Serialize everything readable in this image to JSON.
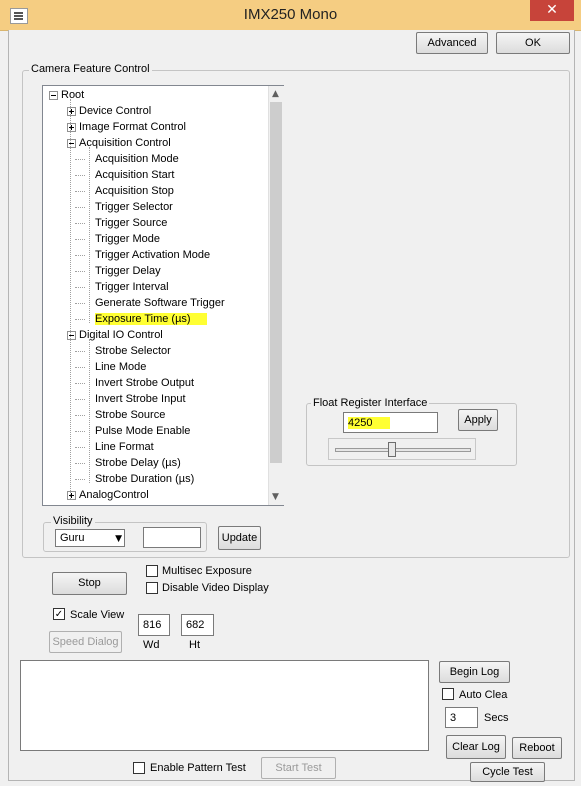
{
  "window": {
    "title": "IMX250 Mono",
    "close_glyph": "✕"
  },
  "header_buttons": {
    "advanced": "Advanced",
    "ok": "OK"
  },
  "feature_group": {
    "label": "Camera Feature Control"
  },
  "tree": {
    "items": [
      {
        "label": "Root",
        "level": 0,
        "expander": "minus"
      },
      {
        "label": "Device Control",
        "level": 1,
        "expander": "plus"
      },
      {
        "label": "Image Format Control",
        "level": 1,
        "expander": "plus"
      },
      {
        "label": "Acquisition Control",
        "level": 1,
        "expander": "minus"
      },
      {
        "label": "Acquisition Mode",
        "level": 2
      },
      {
        "label": "Acquisition Start",
        "level": 2
      },
      {
        "label": "Acquisition Stop",
        "level": 2
      },
      {
        "label": "Trigger Selector",
        "level": 2
      },
      {
        "label": "Trigger Source",
        "level": 2
      },
      {
        "label": "Trigger Mode",
        "level": 2
      },
      {
        "label": "Trigger Activation Mode",
        "level": 2
      },
      {
        "label": "Trigger Delay",
        "level": 2
      },
      {
        "label": "Trigger Interval",
        "level": 2
      },
      {
        "label": "Generate Software Trigger",
        "level": 2
      },
      {
        "label": "Exposure Time (µs)",
        "level": 2,
        "selected": true
      },
      {
        "label": "Digital IO Control",
        "level": 1,
        "expander": "minus"
      },
      {
        "label": "Strobe Selector",
        "level": 2
      },
      {
        "label": "Line Mode",
        "level": 2
      },
      {
        "label": "Invert Strobe Output",
        "level": 2
      },
      {
        "label": "Invert Strobe Input",
        "level": 2
      },
      {
        "label": "Strobe Source",
        "level": 2
      },
      {
        "label": "Pulse Mode Enable",
        "level": 2
      },
      {
        "label": "Line Format",
        "level": 2
      },
      {
        "label": "Strobe Delay (µs)",
        "level": 2
      },
      {
        "label": "Strobe Duration (µs)",
        "level": 2
      },
      {
        "label": "AnalogControl",
        "level": 1,
        "expander": "plus"
      }
    ]
  },
  "float_register": {
    "label": "Float Register Interface",
    "value": "4250",
    "apply": "Apply",
    "slider_fraction": 0.42
  },
  "visibility": {
    "label": "Visibility",
    "selected": "Guru",
    "update": "Update"
  },
  "controls": {
    "stop": "Stop",
    "multisec_exposure": "Multisec Exposure",
    "multisec_checked": false,
    "disable_video": "Disable Video Display",
    "disable_video_checked": false,
    "scale_view": "Scale View",
    "scale_view_checked": true,
    "speed_dialog": "Speed Dialog",
    "width_value": "816",
    "width_label": "Wd",
    "height_value": "682",
    "height_label": "Ht"
  },
  "log": {
    "begin_log": "Begin Log",
    "auto_clear": "Auto Clea",
    "auto_clear_checked": false,
    "secs_value": "3",
    "secs_label": "Secs",
    "clear_log": "Clear Log",
    "reboot": "Reboot",
    "cycle_test": "Cycle Test"
  },
  "pattern": {
    "enable_label": "Enable Pattern Test",
    "enable_checked": false,
    "start_test": "Start Test"
  },
  "colors": {
    "titlebar": "#f5cd82",
    "close": "#c7443a",
    "highlight": "#ffff33"
  }
}
